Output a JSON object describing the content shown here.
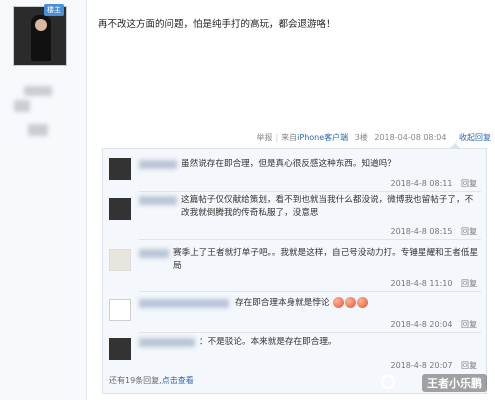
{
  "post": {
    "badge": "楼主",
    "text": "再不改这方面的问题，怕是纯手打的高玩，都会退游咯！",
    "report": "举报",
    "source_prefix": "来自",
    "source_link": "iPhone客户端",
    "floor": "3楼",
    "time": "2018-04-08 08:04",
    "collapse": "收起回复"
  },
  "replies": [
    {
      "text": "虽然说存在即合理，但是真心很反感这种东西。知道吗？",
      "time": "2018-4-8 08:11",
      "reply_label": "回复"
    },
    {
      "text": "这篇帖子仅仅献给策划，看不到也就当我什么都没说，微博我也留帖子了，不改我就倒腾我的传奇私服了，没意思",
      "time": "2018-4-8 08:15",
      "reply_label": "回复"
    },
    {
      "text": "赛季上了王者就打单子吧。。我就是这样，自己号没动力打。专锤星耀和王者低星局",
      "time": "2018-4-8 11:10",
      "reply_label": "回复"
    },
    {
      "text": "存在即合理本身就是悖论",
      "time": "2018-4-8 20:04",
      "reply_label": "回复"
    },
    {
      "text": "：不是驳论。本来就是存在即合理。",
      "time": "2018-4-8 20:07",
      "reply_label": "回复"
    }
  ],
  "footer": {
    "more_text": "还有19条回复,",
    "more_link": "点击查看"
  },
  "watermark": "王者小乐鹏"
}
